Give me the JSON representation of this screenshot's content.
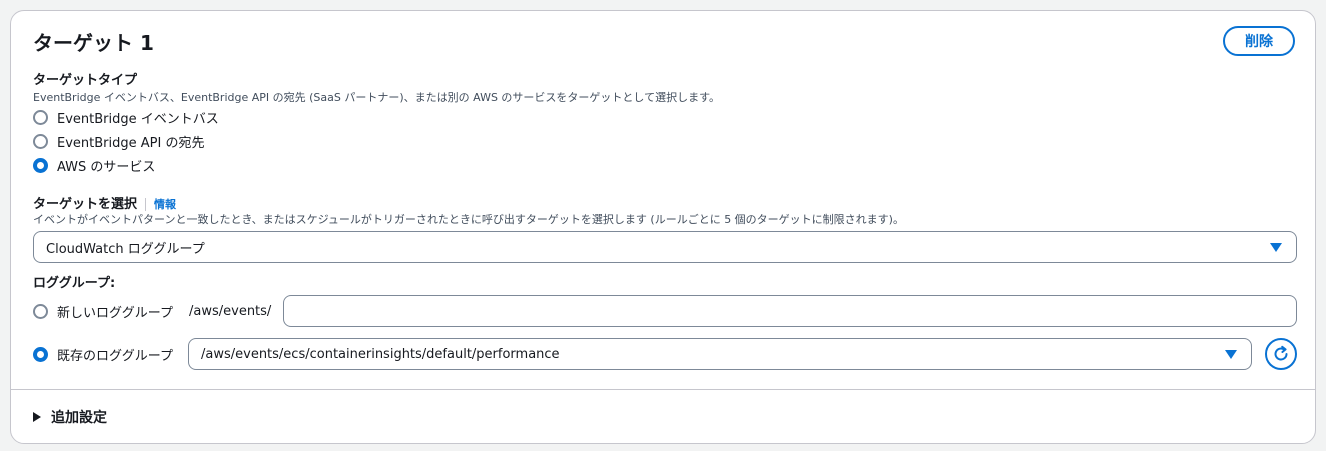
{
  "card": {
    "title": "ターゲット 1",
    "delete_label": "削除"
  },
  "target_type": {
    "label": "ターゲットタイプ",
    "description": "EventBridge イベントバス、EventBridge API の宛先 (SaaS パートナー)、または別の AWS のサービスをターゲットとして選択します。",
    "options": [
      {
        "label": "EventBridge イベントバス",
        "checked": false
      },
      {
        "label": "EventBridge API の宛先",
        "checked": false
      },
      {
        "label": "AWS のサービス",
        "checked": true
      }
    ]
  },
  "select_target": {
    "label": "ターゲットを選択",
    "info_link": "情報",
    "description": "イベントがイベントパターンと一致したとき、またはスケジュールがトリガーされたときに呼び出すターゲットを選択します (ルールごとに 5 個のターゲットに制限されます)。",
    "selected_value": "CloudWatch ロググループ"
  },
  "log_group": {
    "label": "ロググループ:",
    "new": {
      "label": "新しいロググループ",
      "prefix": "/aws/events/",
      "value": "",
      "checked": false
    },
    "existing": {
      "label": "既存のロググループ",
      "selected_value": "/aws/events/ecs/containerinsights/default/performance",
      "checked": true
    }
  },
  "additional_settings": {
    "label": "追加設定"
  },
  "colors": {
    "accent": "#0972d3",
    "border": "#c6c6cd",
    "text": "#16191f"
  }
}
